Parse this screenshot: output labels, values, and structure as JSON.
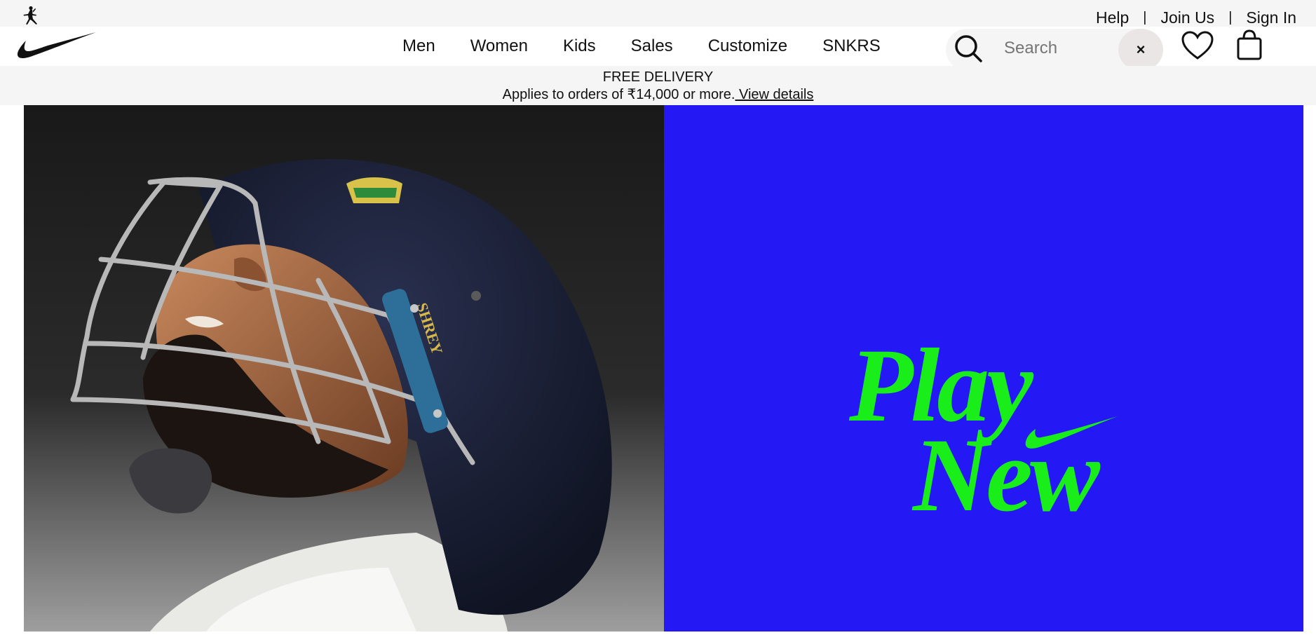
{
  "utility": {
    "links": [
      "Help",
      "Join Us",
      "Sign In"
    ],
    "separator": "|"
  },
  "nav": {
    "items": [
      "Men",
      "Women",
      "Kids",
      "Sales",
      "Customize",
      "SNKRS"
    ]
  },
  "search": {
    "placeholder": "Search",
    "value": "",
    "clear_label": "×"
  },
  "promo": {
    "title": "FREE DELIVERY",
    "text": "Applies to orders of ₹14,000 or more.",
    "link": " View details"
  },
  "hero": {
    "photo_text": "SHREY",
    "brand_line1": "Play",
    "brand_line2": "New",
    "brand_bg": "#2419f5",
    "brand_fg": "#1aee1a"
  },
  "colors": {
    "bar_bg": "#f5f5f5",
    "text": "#111111"
  },
  "icons": [
    "jordan-jumpman-icon",
    "nike-swoosh-icon",
    "search-icon",
    "heart-icon",
    "bag-icon"
  ]
}
